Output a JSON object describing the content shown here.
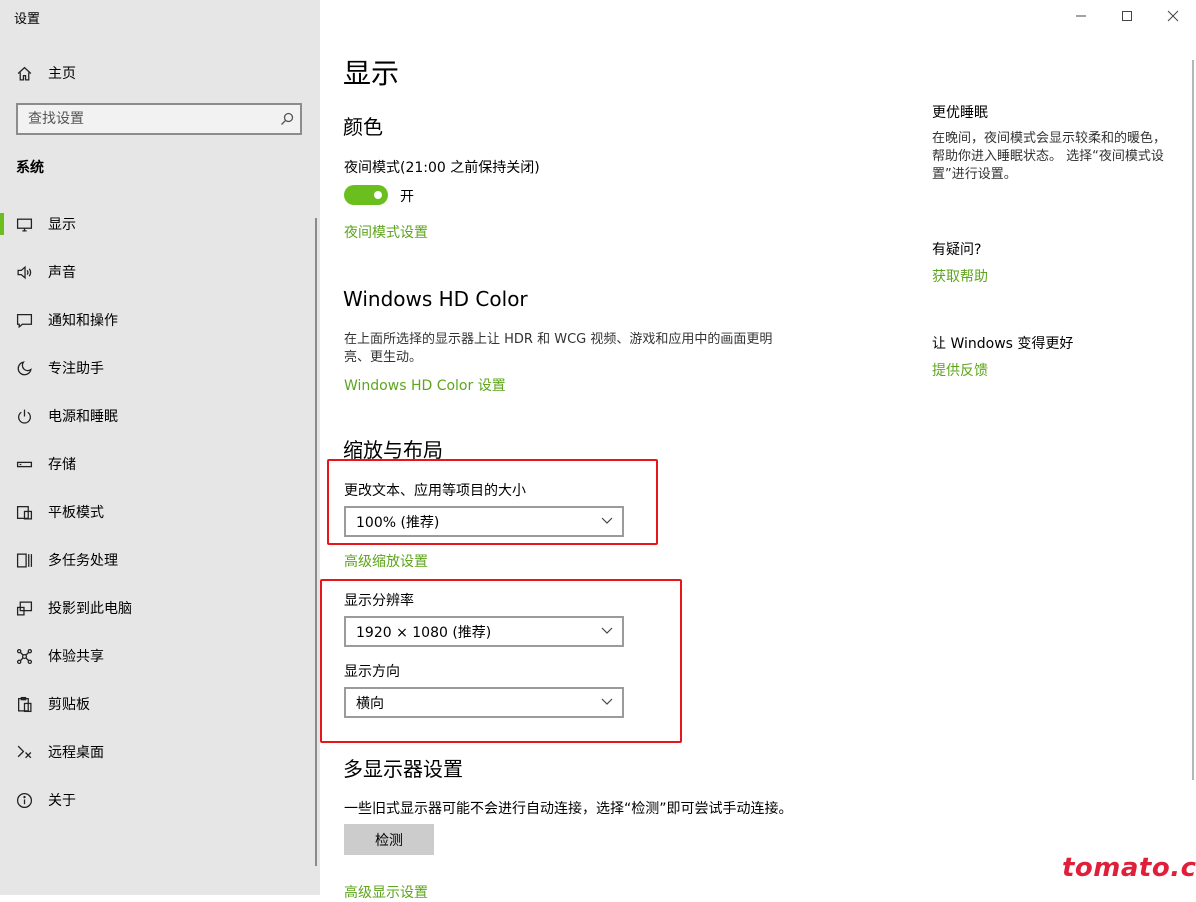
{
  "window": {
    "title": "设置"
  },
  "sidebar": {
    "home_label": "主页",
    "search_placeholder": "查找设置",
    "section_label": "系统",
    "items": [
      {
        "label": "显示",
        "icon": "monitor-icon",
        "active": true
      },
      {
        "label": "声音",
        "icon": "speaker-icon"
      },
      {
        "label": "通知和操作",
        "icon": "notification-icon"
      },
      {
        "label": "专注助手",
        "icon": "moon-icon"
      },
      {
        "label": "电源和睡眠",
        "icon": "power-icon"
      },
      {
        "label": "存储",
        "icon": "storage-icon"
      },
      {
        "label": "平板模式",
        "icon": "tablet-icon"
      },
      {
        "label": "多任务处理",
        "icon": "multitask-icon"
      },
      {
        "label": "投影到此电脑",
        "icon": "project-icon"
      },
      {
        "label": "体验共享",
        "icon": "share-icon"
      },
      {
        "label": "剪贴板",
        "icon": "clipboard-icon"
      },
      {
        "label": "远程桌面",
        "icon": "remote-desktop-icon"
      },
      {
        "label": "关于",
        "icon": "info-icon"
      }
    ]
  },
  "main": {
    "title": "显示",
    "color": {
      "heading": "颜色",
      "night_light_label": "夜间模式(21:00 之前保持关闭)",
      "toggle_state": "开",
      "night_light_link": "夜间模式设置"
    },
    "hdr": {
      "heading": "Windows HD Color",
      "description": "在上面所选择的显示器上让 HDR 和 WCG 视频、游戏和应用中的画面更明亮、更生动。",
      "link": "Windows HD Color 设置"
    },
    "scale": {
      "heading": "缩放与布局",
      "size_label": "更改文本、应用等项目的大小",
      "size_value": "100% (推荐)",
      "advanced_link": "高级缩放设置",
      "resolution_label": "显示分辨率",
      "resolution_value": "1920 × 1080 (推荐)",
      "orientation_label": "显示方向",
      "orientation_value": "横向"
    },
    "multi": {
      "heading": "多显示器设置",
      "description": "一些旧式显示器可能不会进行自动连接，选择“检测”即可尝试手动连接。",
      "detect_button": "检测",
      "advanced_link": "高级显示设置"
    }
  },
  "aside": {
    "sleep_heading": "更优睡眠",
    "sleep_text": "在晚间，夜间模式会显示较柔和的暖色，帮助你进入睡眠状态。 选择“夜间模式设置”进行设置。",
    "question_heading": "有疑问?",
    "help_link": "获取帮助",
    "improve_heading": "让 Windows 变得更好",
    "feedback_link": "提供反馈"
  },
  "watermark": "tomato.cm",
  "colors": {
    "accent": "#6abf1f",
    "link": "#5ea51d",
    "annotation": "#e8161a",
    "sidebar_bg": "#e6e6e6"
  }
}
